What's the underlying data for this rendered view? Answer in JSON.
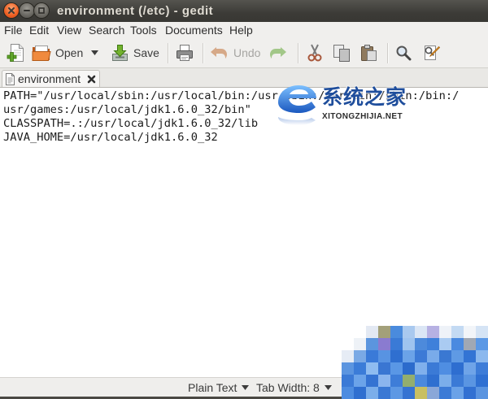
{
  "window": {
    "title": "environment (/etc) - gedit",
    "close_icon": "close-icon",
    "minimize_icon": "minimize-icon",
    "maximize_icon": "maximize-icon"
  },
  "menubar": {
    "items": [
      "File",
      "Edit",
      "View",
      "Search",
      "Tools",
      "Documents",
      "Help"
    ]
  },
  "toolbar": {
    "new": {
      "icon": "new-document-icon"
    },
    "open": {
      "icon": "folder-open-icon",
      "label": "Open",
      "menu_icon": "chevron-down-icon"
    },
    "save": {
      "icon": "save-icon",
      "label": "Save"
    },
    "print": {
      "icon": "printer-icon"
    },
    "undo": {
      "icon": "undo-icon",
      "label": "Undo",
      "enabled": false
    },
    "redo": {
      "icon": "redo-icon",
      "enabled": false
    },
    "cut": {
      "icon": "scissors-icon"
    },
    "copy": {
      "icon": "copy-icon"
    },
    "paste": {
      "icon": "paste-icon"
    },
    "find": {
      "icon": "search-icon"
    },
    "replace": {
      "icon": "find-replace-icon"
    }
  },
  "tabs": [
    {
      "label": "environment",
      "icon": "text-document-icon",
      "close_icon": "close-icon",
      "active": true
    }
  ],
  "document": {
    "lines": [
      "PATH=\"/usr/local/sbin:/usr/local/bin:/usr/sbin:/usr/bin:/sbin:/bin:/",
      "usr/games:/usr/local/jdk1.6.0_32/bin\"",
      "CLASSPATH=.:/usr/local/jdk1.6.0_32/lib",
      "JAVA_HOME=/usr/local/jdk1.6.0_32"
    ]
  },
  "statusbar": {
    "language": "Plain Text",
    "tab_width": "Tab Width: 8",
    "dropdown_icon": "chevron-down-icon"
  },
  "watermark": {
    "brand": "系统之家",
    "domain": "XITONGZHIJIA.NET",
    "logo_icon": "xitongzhijia-logo-icon"
  },
  "colors": {
    "titlebar": "#3c3b37",
    "title_text": "#dfdbd2",
    "close_button": "#ee5f22",
    "disabled_text": "#a6a5a2",
    "watermark_brand": "#1f4e9c",
    "mosaic_blue": "#3a7ad6"
  }
}
